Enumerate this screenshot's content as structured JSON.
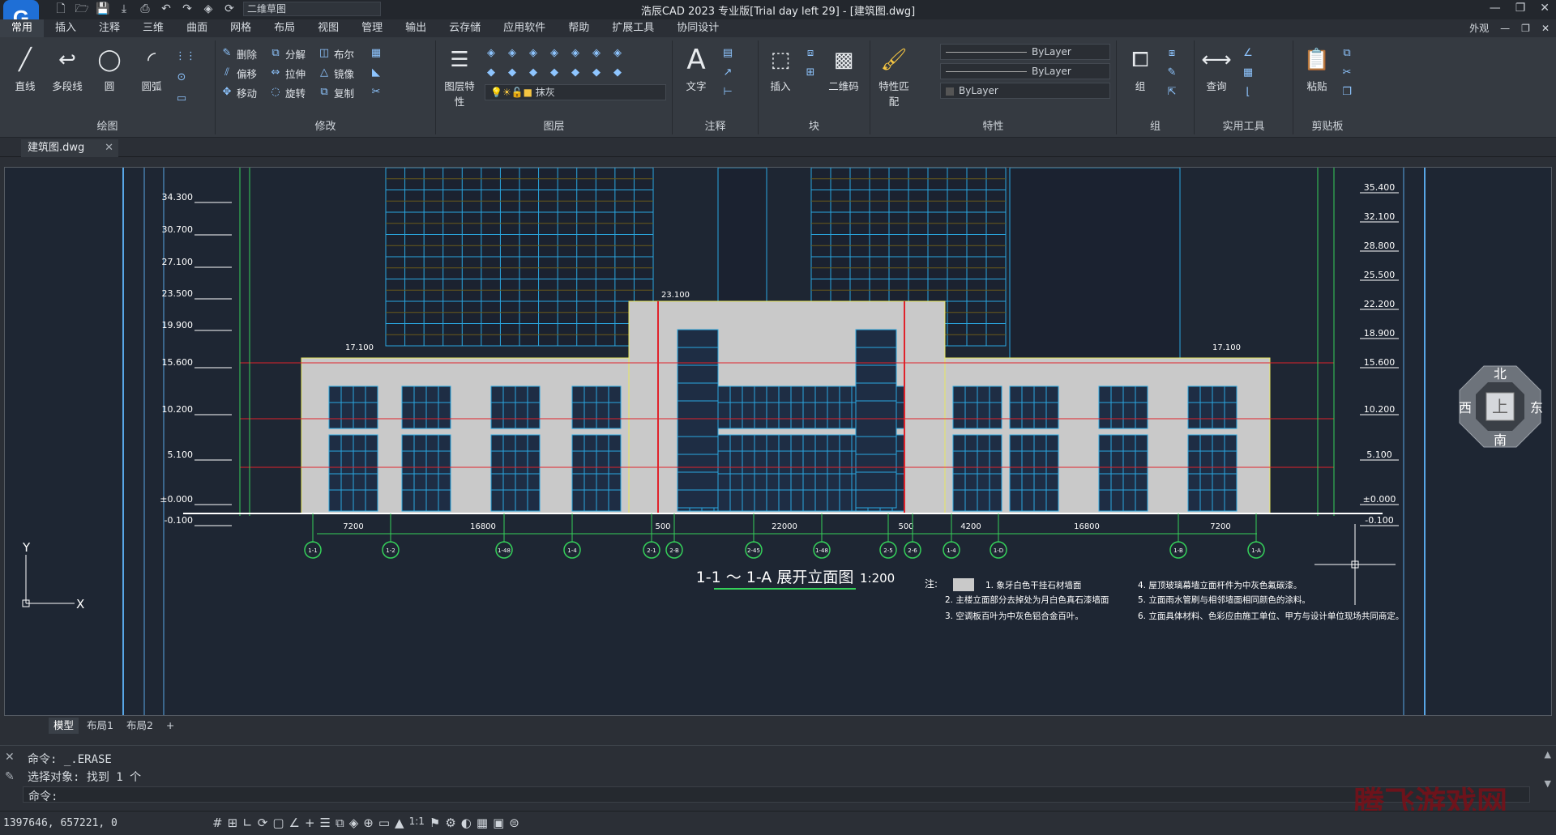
{
  "app": {
    "title": "浩辰CAD 2023 专业版[Trial day left 29] - [建筑图.dwg]",
    "workspace": "二维草图",
    "logo": "G"
  },
  "menu": {
    "tabs": [
      "常用",
      "插入",
      "注释",
      "三维",
      "曲面",
      "网格",
      "布局",
      "视图",
      "管理",
      "输出",
      "云存储",
      "应用软件",
      "帮助",
      "扩展工具",
      "协同设计"
    ],
    "right_label": "外观"
  },
  "ribbon": {
    "draw": {
      "title": "绘图",
      "line": "直线",
      "polyline": "多段线",
      "circle": "圆",
      "arc": "圆弧"
    },
    "modify": {
      "title": "修改",
      "delete": "删除",
      "explode": "分解",
      "boolean": "布尔",
      "offset": "偏移",
      "stretch": "拉伸",
      "mirror": "镜像",
      "move": "移动",
      "rotate": "旋转",
      "copy": "复制"
    },
    "layer": {
      "title": "图层",
      "props": "图层特性",
      "current_layer": "抹灰"
    },
    "annotation": {
      "title": "注释",
      "text": "文字"
    },
    "block": {
      "title": "块",
      "insert": "插入",
      "qrcode": "二维码"
    },
    "properties": {
      "title": "特性",
      "match": "特性匹配",
      "color": "ByLayer",
      "linetype": "ByLayer",
      "lineweight": "ByLayer"
    },
    "group": {
      "title": "组",
      "group": "组"
    },
    "utilities": {
      "title": "实用工具",
      "query": "查询"
    },
    "clipboard": {
      "title": "剪贴板",
      "paste": "粘贴"
    }
  },
  "document": {
    "tab": "建筑图.dwg"
  },
  "drawing": {
    "title": "1-1 ～ 1-A 展开立面图",
    "scale": "1:200",
    "elev_left": [
      "34.300",
      "30.700",
      "27.100",
      "23.500",
      "19.900",
      "15.600",
      "10.200",
      "5.100",
      "±0.000",
      "-0.100"
    ],
    "elev_right": [
      "35.400",
      "32.100",
      "28.800",
      "25.500",
      "22.200",
      "18.900",
      "15.600",
      "10.200",
      "5.100",
      "±0.000",
      "-0.100"
    ],
    "dims": [
      "7200",
      "16800",
      "500",
      "22000",
      "500",
      "4200",
      "16800",
      "7200"
    ],
    "axes": [
      "1-1",
      "1-2",
      "1-48",
      "1-4",
      "2-1",
      "2-B",
      "2-45",
      "1-48",
      "2-5",
      "2-6",
      "1-4",
      "1-D",
      "1-B",
      "1-A"
    ],
    "top_labels": [
      "23.100",
      "17.100",
      "17.100"
    ],
    "notes_head": "注:",
    "notes": [
      "1. 象牙白色干挂石材墙面",
      "2. 主楼立面部分去掉处为月白色真石漆墙面",
      "3. 空调板百叶为中灰色铝合金百叶。",
      "4. 屋顶玻璃幕墙立面杆件为中灰色氟碳漆。",
      "5. 立面雨水管刷与相邻墙面相同颜色的涂料。",
      "6. 立面具体材料、色彩应由施工单位、甲方与设计单位现场共同商定。"
    ],
    "compass": {
      "n": "北",
      "s": "南",
      "e": "东",
      "w": "西",
      "top": "上"
    }
  },
  "layout_tabs": [
    "模型",
    "布局1",
    "布局2",
    "+"
  ],
  "command": {
    "lines": [
      "命令: _.ERASE",
      "选择对象: 找到 1 个"
    ],
    "prompt": "命令:"
  },
  "status": {
    "coords": "1397646, 657221, 0",
    "scale": "1:1"
  },
  "watermark": "腾飞游戏网",
  "colors": {
    "accent": "#1f6fd6",
    "canvas": "#1e2633",
    "grid_blue": "#2aa7e0",
    "wall": "#c9c9c9",
    "red": "#e0232b"
  }
}
